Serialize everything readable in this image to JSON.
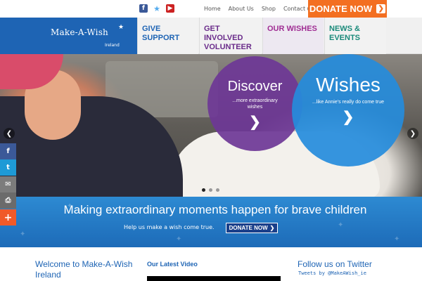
{
  "topbar": {
    "social": [
      {
        "icon": "facebook-icon",
        "glyph": "f"
      },
      {
        "icon": "twitter-icon",
        "glyph": "★"
      },
      {
        "icon": "youtube-icon",
        "glyph": "▶"
      }
    ],
    "links": [
      "Home",
      "About Us",
      "Shop",
      "Contact us"
    ],
    "donate_label": "DONATE NOW",
    "donate_arrow": "❯"
  },
  "logo": {
    "name": "Make-A-Wish",
    "star": "★",
    "sub": "Ireland"
  },
  "nav": {
    "give_support": "GIVE SUPPORT",
    "get_involved": "GET INVOLVED VOLUNTEER",
    "our_wishes": "OUR WISHES",
    "news_events": "NEWS & EVENTS"
  },
  "hero": {
    "discover_title": "Discover",
    "discover_sub": "...more extraordinary wishes",
    "wishes_title": "Wishes",
    "wishes_sub": "...like Annie's really do come true",
    "chevron": "❯",
    "prev": "❮",
    "next": "❯"
  },
  "banner": {
    "title": "Making extraordinary moments happen for brave children",
    "subtitle": "Help us make a wish come true.",
    "donate_label": "DONATE NOW",
    "donate_arrow": "❯"
  },
  "share": {
    "facebook": "f",
    "twitter": "t",
    "mail": "✉",
    "print": "⎙",
    "plus": "+"
  },
  "content": {
    "welcome_title": "Welcome to Make-A-Wish Ireland",
    "latest_video_title": "Our Latest Video",
    "follow_title": "Follow us on Twitter",
    "tweets_by": "Tweets by @MakeAWish_ie"
  },
  "colors": {
    "brand_blue": "#1e64b4",
    "donate_orange": "#f36f21",
    "discover_purple": "#6e3796",
    "wishes_blue": "#258cdc"
  }
}
